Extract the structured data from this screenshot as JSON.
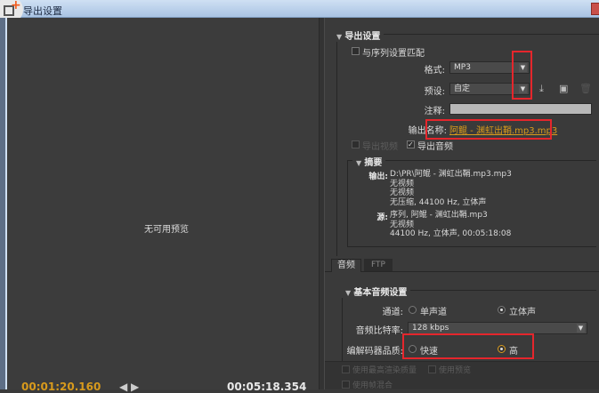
{
  "window": {
    "title": "导出设置"
  },
  "preview": {
    "no_preview": "无可用预览",
    "current_time": "00:01:20.160",
    "duration": "00:05:18.354"
  },
  "export_settings": {
    "header": "导出设置",
    "match_sequence": "与序列设置匹配",
    "format_label": "格式:",
    "format_value": "MP3",
    "preset_label": "预设:",
    "preset_value": "自定",
    "comment_label": "注释:",
    "comment_value": "",
    "output_name_label": "输出名称:",
    "output_name": "阿鲲 - 渊虹出鞘.mp3.mp3",
    "export_video": "导出视频",
    "export_audio": "导出音频"
  },
  "summary": {
    "header": "摘要",
    "output_label": "输出:",
    "output_lines": [
      "D:\\PR\\阿鲲 - 渊虹出鞘.mp3.mp3",
      "无视频",
      "无视频",
      "无压缩, 44100 Hz, 立体声"
    ],
    "source_label": "源:",
    "source_lines": [
      "序列, 阿鲲 - 渊虹出鞘.mp3",
      "无视频",
      "44100 Hz, 立体声, 00:05:18:08"
    ]
  },
  "tabs": [
    {
      "label": "音频"
    },
    {
      "label": "FTP"
    }
  ],
  "audio": {
    "header": "基本音频设置",
    "channels_label": "通道:",
    "mono": "单声道",
    "stereo": "立体声",
    "bitrate_label": "音频比特率:",
    "bitrate_value": "128 kbps",
    "quality_label": "编解码器品质:",
    "fast": "快速",
    "high": "高"
  },
  "footer": {
    "max_quality": "使用最高渲染质量",
    "use_previews": "使用预览",
    "frame_blend": "使用帧混合"
  },
  "colors": {
    "accent": "#d89a1c",
    "highlight": "#e5262c"
  }
}
